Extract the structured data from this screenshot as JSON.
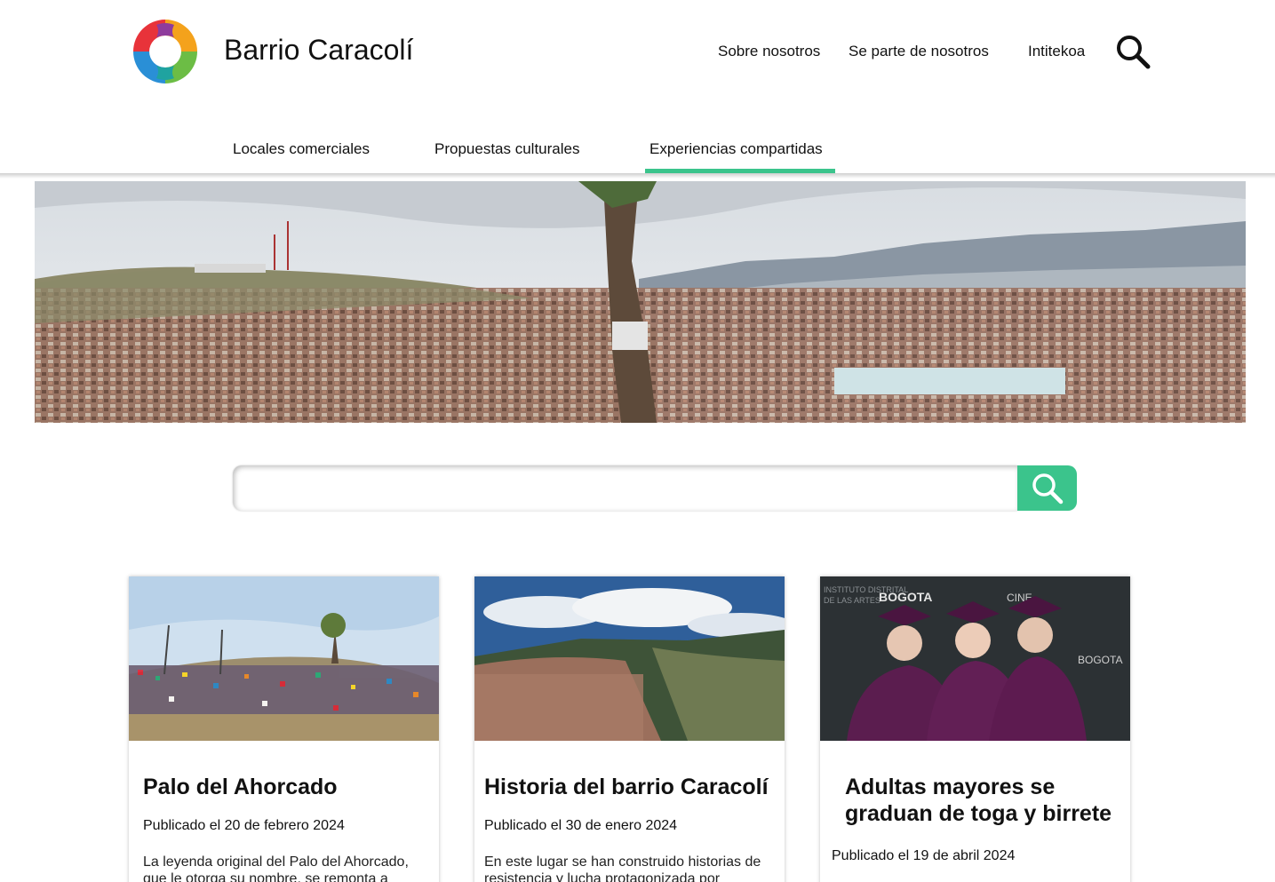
{
  "site": {
    "brand": "Barrio Caracolí"
  },
  "top_nav": {
    "items": [
      "Sobre nosotros",
      "Se parte de nosotros",
      "Intitekoa"
    ]
  },
  "tabs": {
    "items": [
      "Locales comerciales",
      "Propuestas culturales",
      "Experiencias compartidas"
    ],
    "active": "Experiencias compartidas"
  },
  "search": {
    "value": "",
    "placeholder": ""
  },
  "colors": {
    "accent": "#3bc48c"
  },
  "cards": [
    {
      "title": "Palo del Ahorcado",
      "date": "Publicado el 20 de febrero 2024",
      "excerpt": "La leyenda original del Palo del Ahorcado, que le otorga su nombre, se remonta a"
    },
    {
      "title": "Historia del barrio Caracolí",
      "date": "Publicado el 30 de enero 2024",
      "excerpt": "En este lugar se han construido historias de resistencia y lucha protagonizada por"
    },
    {
      "title": "Adultas mayores se graduan de toga y birrete",
      "date": "Publicado el 19 de abril 2024",
      "excerpt": ""
    }
  ]
}
